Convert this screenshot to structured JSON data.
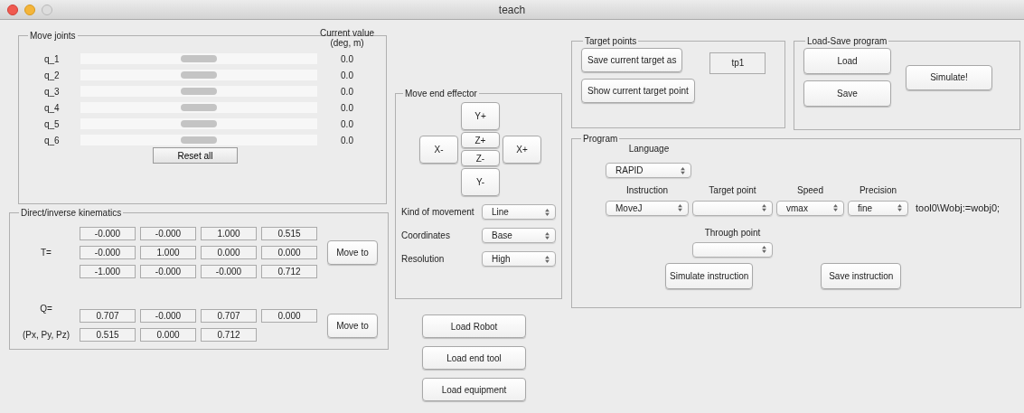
{
  "window": {
    "title": "teach"
  },
  "move_joints": {
    "title": "Move joints",
    "value_header": "Current value (deg, m)",
    "reset_button": "Reset all",
    "joints": [
      {
        "label": "q_1",
        "level": 0.5,
        "value": "0.0"
      },
      {
        "label": "q_2",
        "level": 0.5,
        "value": "0.0"
      },
      {
        "label": "q_3",
        "level": 0.5,
        "value": "0.0"
      },
      {
        "label": "q_4",
        "level": 0.5,
        "value": "0.0"
      },
      {
        "label": "q_5",
        "level": 0.5,
        "value": "0.0"
      },
      {
        "label": "q_6",
        "level": 0.5,
        "value": "0.0"
      }
    ]
  },
  "kinematics": {
    "title": "Direct/inverse kinematics",
    "t_label": "T=",
    "t_rows": [
      [
        "-0.000",
        "-0.000",
        "1.000",
        "0.515"
      ],
      [
        "-0.000",
        "1.000",
        "0.000",
        "0.000"
      ],
      [
        "-1.000",
        "-0.000",
        "-0.000",
        "0.712"
      ]
    ],
    "t_button": "Move to",
    "q_label": "Q=",
    "q_values": [
      "0.707",
      "-0.000",
      "0.707",
      "0.000"
    ],
    "p_label": "(Px, Py, Pz)",
    "p_values": [
      "0.515",
      "0.000",
      "0.712"
    ],
    "q_button": "Move to"
  },
  "end_effector": {
    "title": "Move end effector",
    "jog_buttons": [
      "Y+",
      "X-",
      "Z+",
      "Z-",
      "X+",
      "Y-"
    ],
    "settings": [
      {
        "label": "Kind of movement",
        "value": "Line"
      },
      {
        "label": "Coordinates",
        "value": "Base"
      },
      {
        "label": "Resolution",
        "value": "High"
      }
    ]
  },
  "load_buttons": [
    "Load Robot",
    "Load end tool",
    "Load equipment"
  ],
  "target_points": {
    "title": "Target points",
    "save_button": "Save current target as",
    "name_field": "tp1",
    "show_button": "Show current target point"
  },
  "load_save": {
    "title": "Load-Save program",
    "load_button": "Load",
    "save_button": "Save",
    "simulate_button": "Simulate!"
  },
  "program": {
    "title": "Program",
    "language_label": "Language",
    "language": "RAPID",
    "fields": [
      {
        "label": "Instruction",
        "value": "MoveJ"
      },
      {
        "label": "Target point"
      },
      {
        "label": "Speed",
        "value": "vmax"
      },
      {
        "label": "Precision",
        "value": "fine"
      }
    ],
    "suffix": "tool0\\Wobj:=wobj0;",
    "through_label": "Through point",
    "simulate_button": "Simulate instruction",
    "save_button": "Save instruction"
  }
}
